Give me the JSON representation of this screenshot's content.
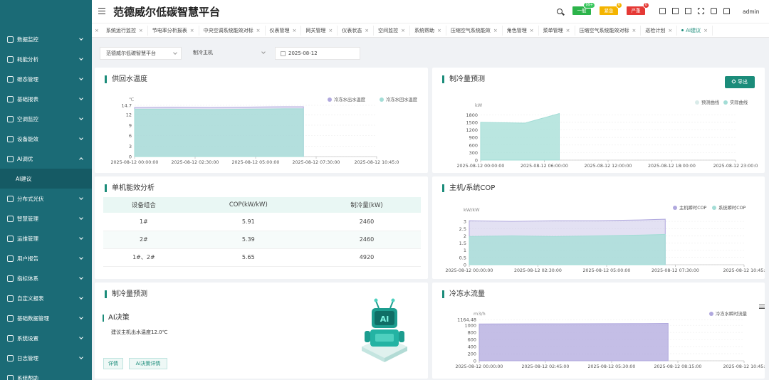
{
  "app": {
    "title": "范德威尔低碳智慧平台",
    "user": "admin"
  },
  "alerts": [
    {
      "label": "一般",
      "color": "#2cb34a",
      "count": "99+"
    },
    {
      "label": "紧急",
      "color": "#f4b400",
      "count": "6"
    },
    {
      "label": "严重",
      "color": "#e53935",
      "count": "0"
    }
  ],
  "sidebar": {
    "items": [
      {
        "label": "数据监控",
        "expand": "down"
      },
      {
        "label": "耗能分析",
        "expand": "down"
      },
      {
        "label": "碳态管理",
        "expand": "down"
      },
      {
        "label": "基础报表",
        "expand": "down"
      },
      {
        "label": "空调监控",
        "expand": "down"
      },
      {
        "label": "设备能效",
        "expand": "down"
      },
      {
        "label": "AI调优",
        "expand": "up"
      },
      {
        "label": "AI建议",
        "sub": true
      },
      {
        "label": "分布式光伏",
        "expand": "down"
      },
      {
        "label": "智慧管理",
        "expand": "down"
      },
      {
        "label": "运维管理",
        "expand": "down"
      },
      {
        "label": "用户报告",
        "expand": "down"
      },
      {
        "label": "指标体系",
        "expand": "down"
      },
      {
        "label": "自定义报表",
        "expand": "down"
      },
      {
        "label": "基础数据管理",
        "expand": "down"
      },
      {
        "label": "系统设置",
        "expand": "down"
      },
      {
        "label": "日志管理",
        "expand": "down"
      },
      {
        "label": "系统帮助",
        "expand": ""
      }
    ]
  },
  "tabs": [
    {
      "label": "系统运行监控"
    },
    {
      "label": "节电率分析报表"
    },
    {
      "label": "中央空调系统能效对标"
    },
    {
      "label": "仪表管理"
    },
    {
      "label": "网关管理"
    },
    {
      "label": "仪表状态"
    },
    {
      "label": "空间监控"
    },
    {
      "label": "系统帮助"
    },
    {
      "label": "压缩空气系统能效"
    },
    {
      "label": "角色管理"
    },
    {
      "label": "菜单管理"
    },
    {
      "label": "压缩空气系统能效对标"
    },
    {
      "label": "巡检计划"
    },
    {
      "label": "AI建议",
      "active": true
    }
  ],
  "filters": {
    "platform": "范德威尔低碳智慧平台",
    "equipment": "制冷主机",
    "date": "2025-08-12"
  },
  "panels": {
    "supply_temp": {
      "title": "供回水温度"
    },
    "cooling_forecast": {
      "title": "制冷量预测",
      "export": "导出"
    },
    "unit_efficiency": {
      "title": "单机能效分析",
      "headers": [
        "设备组合",
        "COP(kW/kW)",
        "制冷量(kW)"
      ],
      "rows": [
        [
          "1#",
          "5.91",
          "2460"
        ],
        [
          "2#",
          "5.39",
          "2460"
        ],
        [
          "1#、2#",
          "5.65",
          "4920"
        ]
      ]
    },
    "host_cop": {
      "title": "主机/系统COP"
    },
    "ai_decision": {
      "title": "制冷量预测",
      "subtitle": "AI决策",
      "advice": "建议主机出水温度12.0℃",
      "btn_detail": "详情",
      "btn_ai_detail": "AI决策详情",
      "robot_text": "AI"
    },
    "chilled_flow": {
      "title": "冷冻水流量"
    }
  },
  "chart_data": [
    {
      "id": "temp",
      "type": "area",
      "ylabel": "℃",
      "yticks": [
        0,
        3,
        6,
        9,
        12,
        14.7
      ],
      "ylim": [
        0,
        14.7
      ],
      "xticks": [
        "2025-08-12 00:00:00",
        "2025-08-12 02:30:00",
        "2025-08-12 05:00:00",
        "2025-08-12 07:30:00",
        "2025-08-12 10:45:0"
      ],
      "xlim": [
        0,
        645
      ],
      "series": [
        {
          "name": "冷冻水出水温度",
          "color": "#b0a8de",
          "x": [
            0,
            100,
            200,
            300,
            400,
            450
          ],
          "y": [
            14.1,
            14.2,
            14.1,
            14.2,
            14.3,
            14.3
          ]
        },
        {
          "name": "冷冻水回水温度",
          "color": "#a3ddd6",
          "x": [
            0,
            100,
            200,
            300,
            400,
            450
          ],
          "y": [
            13.6,
            13.6,
            13.5,
            13.6,
            13.7,
            13.7
          ]
        }
      ]
    },
    {
      "id": "forecast",
      "type": "area",
      "ylabel": "kW",
      "yticks": [
        0,
        300,
        600,
        900,
        1200,
        1500,
        1800
      ],
      "ylim": [
        0,
        1950
      ],
      "xticks": [
        "2025-08-12 00:00:00",
        "2025-08-12 06:00:00",
        "2025-08-12 12:00:00",
        "2025-08-12 18:00:00",
        "2025-08-12 23:00:0"
      ],
      "xlim": [
        0,
        23
      ],
      "series": [
        {
          "name": "预测曲线",
          "color": "#d9ebe9",
          "x": [],
          "y": []
        },
        {
          "name": "实际曲线",
          "color": "#a3ddd6",
          "x": [
            0,
            4,
            7.1
          ],
          "y": [
            1500,
            1470,
            1850
          ]
        }
      ]
    },
    {
      "id": "cop",
      "type": "area",
      "ylabel": "kW/kW",
      "yticks": [
        0,
        0.5,
        1,
        1.5,
        2,
        2.5,
        3
      ],
      "ylim": [
        0,
        3.4
      ],
      "xticks": [
        "2025-08-12 00:00:00",
        "2025-08-12 02:30:00",
        "2025-08-12 05:00:00",
        "2025-08-12 07:30:00",
        "2025-08-12 10:45:"
      ],
      "xlim": [
        0,
        645
      ],
      "series": [
        {
          "name": "主机瞬时COP",
          "color": "#b0a8de",
          "x": [
            0,
            100,
            200,
            300,
            400,
            460
          ],
          "y": [
            3.05,
            3.0,
            3.05,
            3.05,
            3.1,
            3.15
          ]
        },
        {
          "name": "系统瞬时COP",
          "color": "#a3ddd6",
          "x": [
            0,
            100,
            200,
            300,
            400,
            460
          ],
          "y": [
            1.95,
            2.0,
            1.95,
            2.0,
            2.05,
            2.1
          ]
        }
      ]
    },
    {
      "id": "flow",
      "type": "area",
      "ylabel": "m3/h",
      "yticks": [
        0,
        200,
        400,
        600,
        800,
        1000,
        1164.48
      ],
      "ylim": [
        0,
        1164.48
      ],
      "xticks": [
        "2025-08-12 00:00:00",
        "2025-08-12 02:45:00",
        "2025-08-12 05:30:00",
        "2025-08-12 08:15:00",
        "2025-08-12 10:45:"
      ],
      "xlim": [
        0,
        645
      ],
      "series": [
        {
          "name": "冷冻水瞬时流量",
          "color": "#b0a8de",
          "x": [
            0,
            200,
            400,
            460
          ],
          "y": [
            1040,
            1045,
            1050,
            1055
          ]
        }
      ]
    }
  ]
}
